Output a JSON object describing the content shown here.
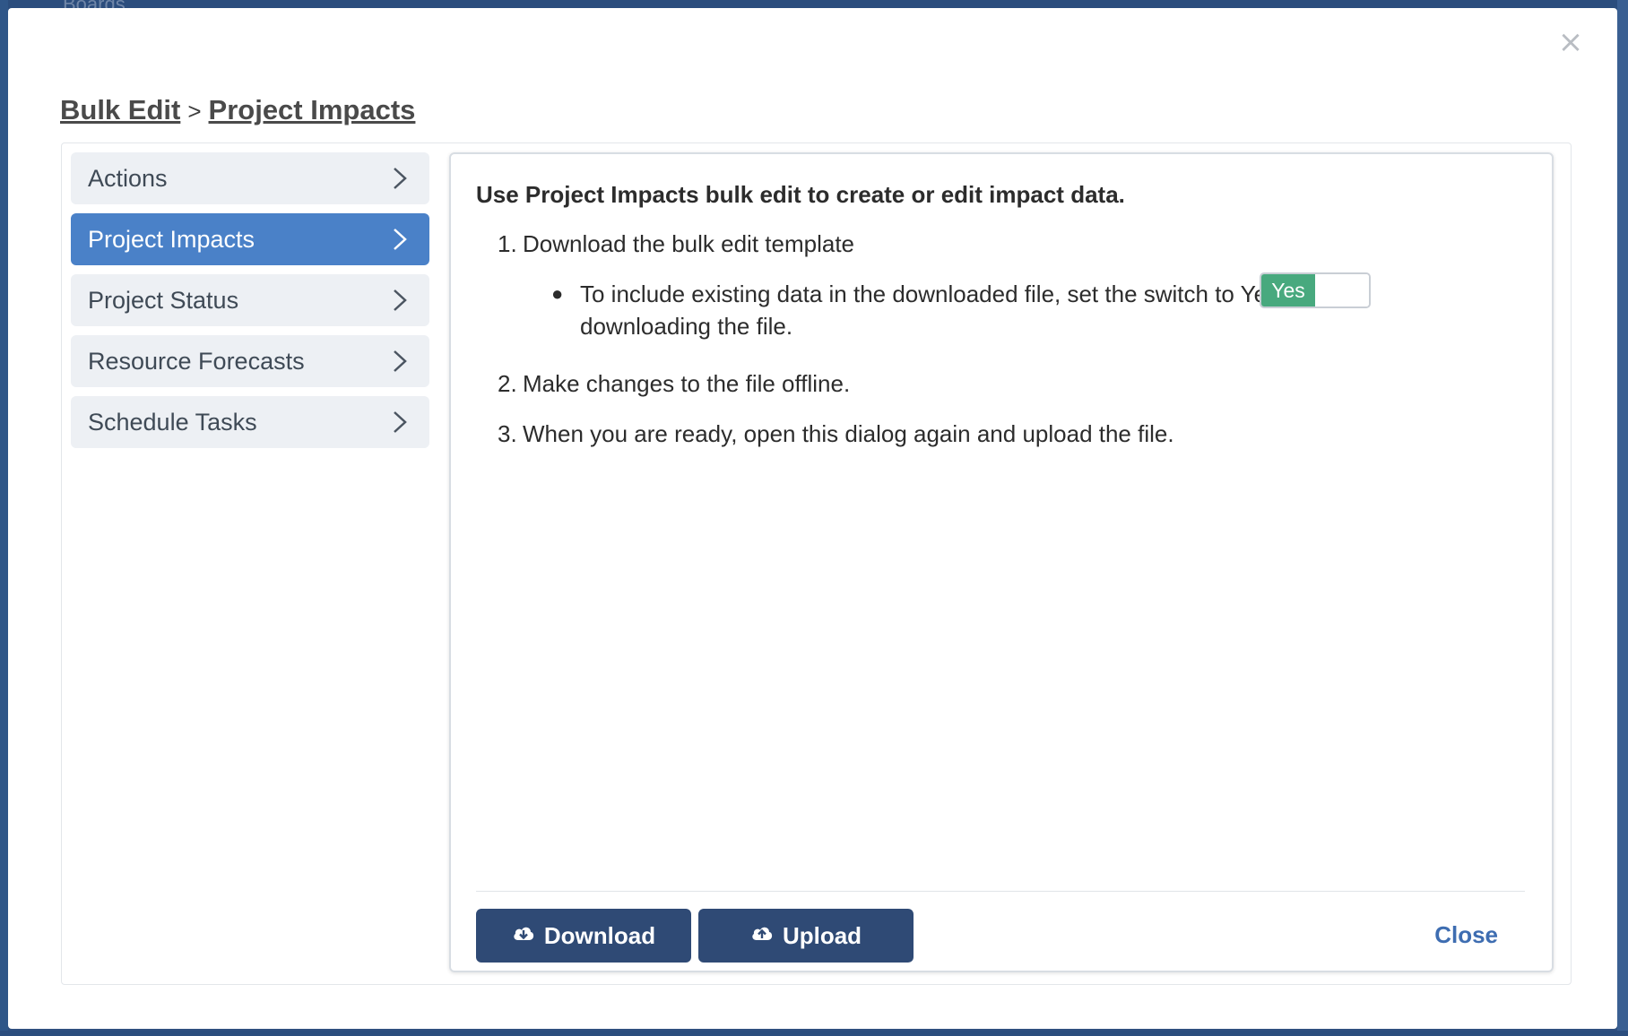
{
  "background": {
    "text": "Boards"
  },
  "modal": {
    "close_icon": "close-icon",
    "breadcrumb": {
      "root": "Bulk Edit",
      "separator": ">",
      "current": "Project Impacts"
    },
    "sidebar": {
      "items": [
        {
          "label": "Actions",
          "active": false
        },
        {
          "label": "Project Impacts",
          "active": true
        },
        {
          "label": "Project Status",
          "active": false
        },
        {
          "label": "Resource Forecasts",
          "active": false
        },
        {
          "label": "Schedule Tasks",
          "active": false
        }
      ]
    },
    "content": {
      "intro": "Use Project Impacts bulk edit to create or edit impact data.",
      "steps": [
        {
          "num": "1.",
          "text": "Download the bulk edit template"
        },
        {
          "num": "2.",
          "text": "Make changes to the file offline."
        },
        {
          "num": "3.",
          "text": "When you are ready, open this dialog again and upload the file."
        }
      ],
      "sub_bullet": "To include existing data in the downloaded file, set the switch to Yes before downloading the file.",
      "toggle": {
        "label": "Yes",
        "state": true,
        "color": "#48a97e"
      }
    },
    "footer": {
      "download_label": "Download",
      "upload_label": "Upload",
      "close_label": "Close"
    }
  },
  "colors": {
    "accent": "#4a81c8",
    "button": "#2f4a75",
    "link": "#3e6db1"
  }
}
